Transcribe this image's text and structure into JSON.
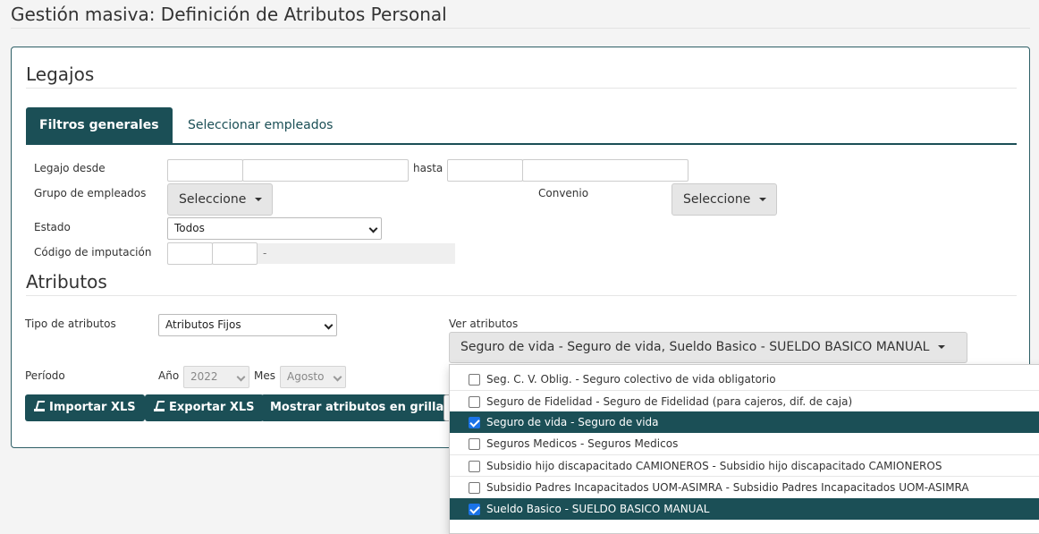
{
  "page": {
    "title": "Gestión masiva: Definición de Atributos Personal"
  },
  "legajos": {
    "title": "Legajos",
    "tabs": [
      {
        "label": "Filtros generales",
        "active": true
      },
      {
        "label": "Seleccionar empleados",
        "active": false
      }
    ],
    "filters": {
      "legajo_desde_label": "Legajo desde",
      "hasta_label": "hasta",
      "grupo_label": "Grupo de empleados",
      "grupo_value": "Seleccione",
      "convenio_label": "Convenio",
      "convenio_value": "Seleccione",
      "estado_label": "Estado",
      "estado_value": "Todos",
      "codigo_label": "Código de imputación",
      "codigo_desc": "-"
    }
  },
  "atributos": {
    "title": "Atributos",
    "tipo_label": "Tipo de atributos",
    "tipo_value": "Atributos Fijos",
    "ver_label": "Ver atributos",
    "ver_value": "Seguro de vida - Seguro de vida, Sueldo Basico - SUELDO BASICO MANUAL",
    "periodo_label": "Período",
    "anio_label": "Año",
    "anio_value": "2022",
    "mes_label": "Mes",
    "mes_value": "Agosto"
  },
  "actions": {
    "importar": "Importar XLS",
    "exportar": "Exportar XLS",
    "mostrar": "Mostrar atributos en grilla"
  },
  "dropdown": {
    "items": [
      {
        "label": "Seg. C. V. Oblig. - Seguro colectivo de vida obligatorio",
        "checked": false
      },
      {
        "label": "Seguro de Fidelidad - Seguro de Fidelidad (para cajeros, dif. de caja)",
        "checked": false
      },
      {
        "label": "Seguro de vida - Seguro de vida",
        "checked": true
      },
      {
        "label": "Seguros Medicos - Seguros Medicos",
        "checked": false
      },
      {
        "label": "Subsidio hijo discapacitado CAMIONEROS - Subsidio hijo discapacitado CAMIONEROS",
        "checked": false
      },
      {
        "label": "Subsidio Padres Incapacitados UOM-ASIMRA - Subsidio Padres Incapacitados UOM-ASIMRA",
        "checked": false
      },
      {
        "label": "Sueldo Basico - SUELDO BASICO MANUAL",
        "checked": true
      }
    ]
  },
  "colors": {
    "accent": "#1b4f56",
    "checkbox": "#1a73e8"
  }
}
